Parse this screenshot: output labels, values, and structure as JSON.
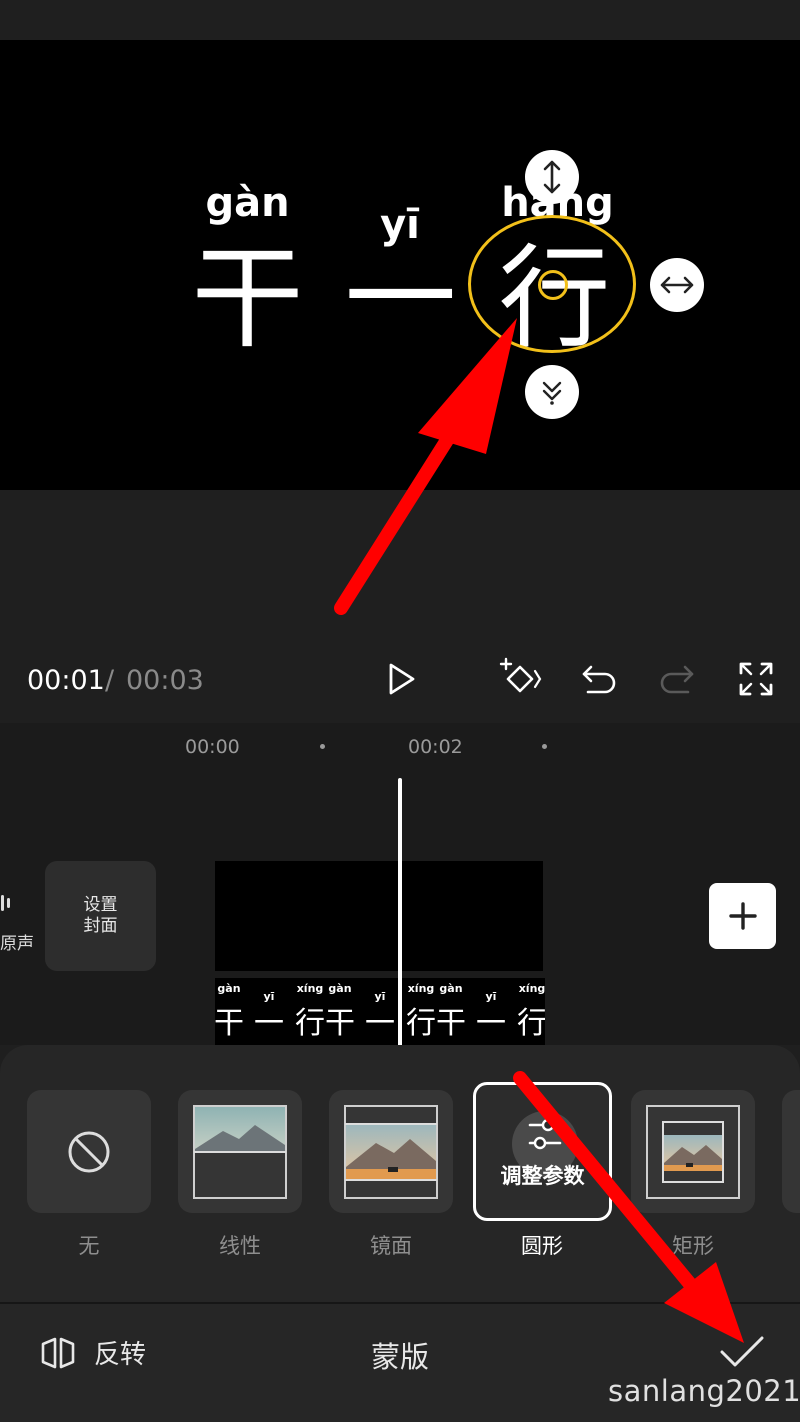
{
  "preview": {
    "characters": [
      {
        "pinyin": "gàn",
        "hanzi": "干"
      },
      {
        "pinyin": "yī",
        "hanzi": "一"
      },
      {
        "pinyin": "háng",
        "hanzi": "行"
      }
    ]
  },
  "playback": {
    "current_time": "00:01",
    "separator": "/",
    "total_time": "00:03"
  },
  "timeline": {
    "ruler": [
      "00:00",
      "00:02"
    ],
    "original_audio_label": "原声",
    "cover_label_line1": "设置",
    "cover_label_line2": "封面",
    "text_clip": [
      {
        "pinyin": "gàn",
        "hanzi": "干"
      },
      {
        "pinyin": "yī",
        "hanzi": "一"
      },
      {
        "pinyin": "xíng",
        "hanzi": "行"
      }
    ]
  },
  "mask_panel": {
    "options": [
      {
        "label": "无",
        "icon": "none-icon"
      },
      {
        "label": "线性",
        "icon": "linear-mask-icon"
      },
      {
        "label": "镜面",
        "icon": "mirror-mask-icon"
      },
      {
        "label": "圆形",
        "icon": "circle-mask-icon",
        "selected": true,
        "overlay_text": "调整参数"
      },
      {
        "label": "矩形",
        "icon": "rectangle-mask-icon"
      }
    ],
    "flip_label": "反转",
    "title": "蒙版"
  },
  "watermark": "sanlang2021",
  "colors": {
    "accent_yellow": "#f2c01a",
    "annotation_red": "#ff0000",
    "background": "#1f1f1f"
  }
}
